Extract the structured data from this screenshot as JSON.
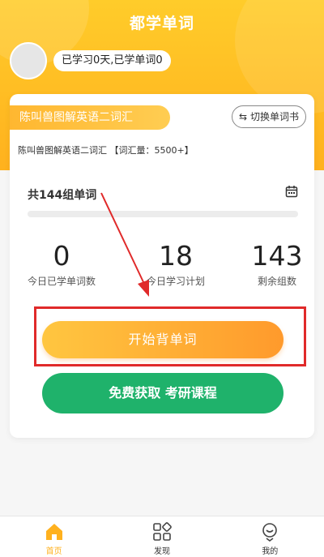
{
  "header": {
    "title": "都学单词"
  },
  "user": {
    "study_status": "已学习0天,已学单词0"
  },
  "book": {
    "tag": "陈叫兽图解英语二词汇",
    "switch_label": "切换单词书",
    "info": "陈叫兽图解英语二词汇 【词汇量：5500+】"
  },
  "plan": {
    "groups_label": "共144组单词",
    "progress": 0,
    "stats": [
      {
        "value": "0",
        "label": "今日已学单词数"
      },
      {
        "value": "18",
        "label": "今日学习计划"
      },
      {
        "value": "143",
        "label": "剩余组数"
      }
    ]
  },
  "actions": {
    "start_label": "开始背单词",
    "course_label": "免费获取 考研课程"
  },
  "tabs": [
    {
      "label": "首页",
      "icon": "home-icon",
      "active": true
    },
    {
      "label": "发现",
      "icon": "discover-icon",
      "active": false
    },
    {
      "label": "我的",
      "icon": "profile-icon",
      "active": false
    }
  ],
  "colors": {
    "accent": "#ffb11e",
    "green": "#1fb26b",
    "highlight": "#e02a2a"
  }
}
